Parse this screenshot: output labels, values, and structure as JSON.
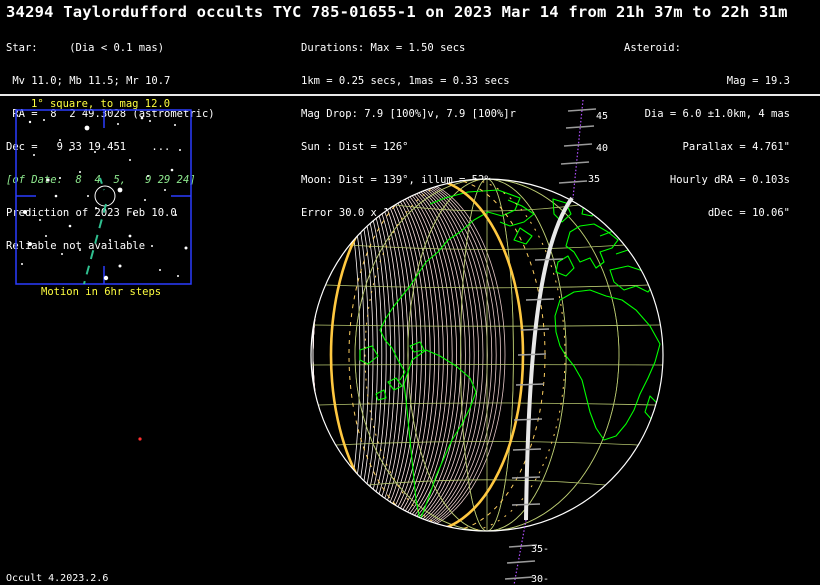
{
  "title": "34294 Taylordufford occults TYC 785-01655-1 on 2023 Mar 14 from 21h 37m to 22h 31m",
  "left_block": [
    "Star:     (Dia < 0.1 mas)",
    " Mv 11.0; Mb 11.5; Mr 10.7",
    " RA =  8  2 49.3028 (astrometric)",
    "Dec =   9 33 19.451    ...",
    "[of Date:  8  4  5,   9 29 24]",
    "Prediction of 2023 Feb 10.0",
    "Reliable not available"
  ],
  "mid_block": [
    "Durations: Max = 1.50 secs",
    "1km = 0.25 secs, 1mas = 0.33 secs",
    "Mag Drop: 7.9 [100%]v, 7.9 [100%]r",
    "Sun : Dist = 126°",
    "Moon: Dist = 139°, illum = 52%",
    "Error 30.0 x 17.0 mas in PA 104°"
  ],
  "right_block": [
    "Asteroid:",
    "Mag = 19.3",
    "Dia = 6.0 ±1.0km, 4 mas",
    "Parallax = 4.761\"",
    "Hourly dRA = 0.103s",
    "dDec = 10.06\""
  ],
  "inset": {
    "top_caption": "1° square, to mag 12.0",
    "bottom_caption": "Motion in 6hr steps"
  },
  "path_ticks": {
    "north": [
      "45",
      "40",
      "35"
    ],
    "south": [
      "35-",
      "30-"
    ]
  },
  "footer": "Occult 4.2023.2.6",
  "colors": {
    "coast": "#00ff00",
    "grid": "#b8c870",
    "limb": "#ffc840",
    "path": "#ffffff",
    "ticks": "#b050ff"
  }
}
